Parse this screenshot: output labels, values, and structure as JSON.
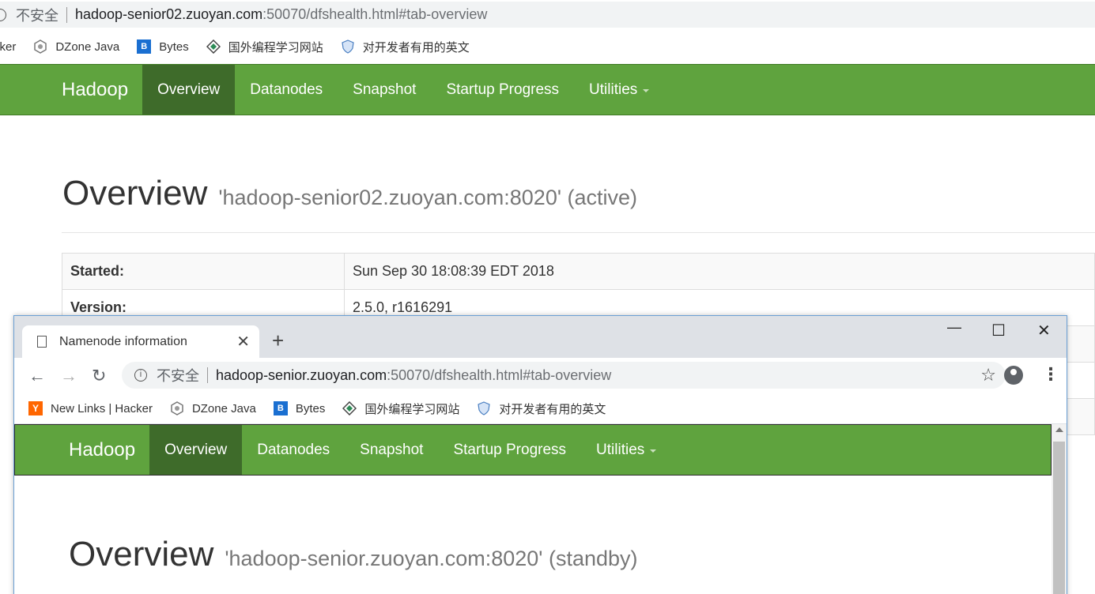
{
  "background": {
    "address_bar": {
      "insecure_label": "不安全",
      "host": "hadoop-senior02.zuoyan.com",
      "path": ":50070/dfshealth.html#tab-overview"
    },
    "bookmarks": [
      {
        "label": "cker",
        "icon": "hacker-news-icon"
      },
      {
        "label": "DZone Java",
        "icon": "dzone-icon"
      },
      {
        "label": "Bytes",
        "icon": "bytes-icon"
      },
      {
        "label": "国外编程学习网站",
        "icon": "diamond-icon"
      },
      {
        "label": "对开发者有用的英文",
        "icon": "shield-icon"
      }
    ],
    "navbar": {
      "brand": "Hadoop",
      "items": [
        "Overview",
        "Datanodes",
        "Snapshot",
        "Startup Progress",
        "Utilities"
      ],
      "active": "Overview"
    },
    "heading": {
      "title": "Overview",
      "subtitle": "'hadoop-senior02.zuoyan.com:8020' (active)"
    },
    "table": [
      {
        "key": "Started:",
        "value": "Sun Sep 30 18:08:39 EDT 2018"
      },
      {
        "key": "Version:",
        "value": "2.5.0, r1616291"
      },
      {
        "key": "",
        "value": ""
      },
      {
        "key": "",
        "value": ""
      },
      {
        "key": "",
        "value": ""
      }
    ]
  },
  "foreground": {
    "tab": {
      "title": "Namenode information",
      "close": "✕"
    },
    "new_tab": "+",
    "window_controls": {
      "minimize": "—",
      "maximize": "☐",
      "close": "✕"
    },
    "toolbar": {
      "back": "←",
      "forward": "→",
      "reload": "↻",
      "star": "☆",
      "menu": "⋮"
    },
    "address_bar": {
      "insecure_label": "不安全",
      "host": "hadoop-senior.zuoyan.com",
      "path": ":50070/dfshealth.html#tab-overview"
    },
    "bookmarks": [
      {
        "label": "New Links | Hacker",
        "icon": "hacker-news-icon"
      },
      {
        "label": "DZone Java",
        "icon": "dzone-icon"
      },
      {
        "label": "Bytes",
        "icon": "bytes-icon"
      },
      {
        "label": "国外编程学习网站",
        "icon": "diamond-icon"
      },
      {
        "label": "对开发者有用的英文",
        "icon": "shield-icon"
      }
    ],
    "navbar": {
      "brand": "Hadoop",
      "items": [
        "Overview",
        "Datanodes",
        "Snapshot",
        "Startup Progress",
        "Utilities"
      ],
      "active": "Overview"
    },
    "heading": {
      "title": "Overview",
      "subtitle": "'hadoop-senior.zuoyan.com:8020' (standby)"
    }
  },
  "colors": {
    "navbar_green": "#5fa33e",
    "navbar_active": "#3e6b2a",
    "hacker_news_orange": "#ff6600",
    "bytes_blue": "#1a6fd1"
  }
}
